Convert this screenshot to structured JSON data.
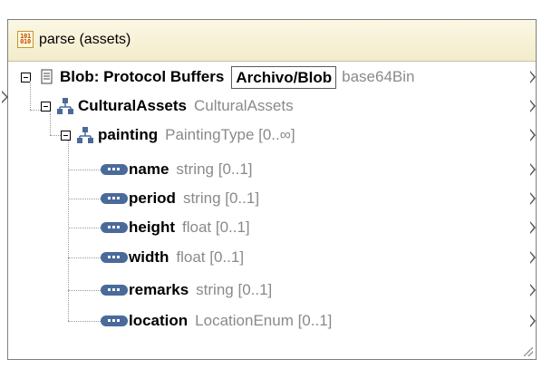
{
  "component": {
    "title": "parse (assets)",
    "title_icon": "binary-data-icon",
    "root": {
      "label": "Blob: Protocol Buffers",
      "button_label": "Archivo/Blob",
      "encoding": "base64Bin"
    },
    "tree": [
      {
        "label": "CulturalAssets",
        "type": "CulturalAssets",
        "icon": "complex-element-icon"
      },
      {
        "label": "painting",
        "type": "PaintingType [0..∞]",
        "icon": "complex-element-icon"
      },
      {
        "label": "name",
        "type": "string [0..1]",
        "icon": "simple-element-icon"
      },
      {
        "label": "period",
        "type": "string [0..1]",
        "icon": "simple-element-icon"
      },
      {
        "label": "height",
        "type": "float [0..1]",
        "icon": "simple-element-icon"
      },
      {
        "label": "width",
        "type": "float [0..1]",
        "icon": "simple-element-icon"
      },
      {
        "label": "remarks",
        "type": "string [0..1]",
        "icon": "simple-element-icon"
      },
      {
        "label": "location",
        "type": "LocationEnum [0..1]",
        "icon": "simple-element-icon"
      }
    ]
  }
}
